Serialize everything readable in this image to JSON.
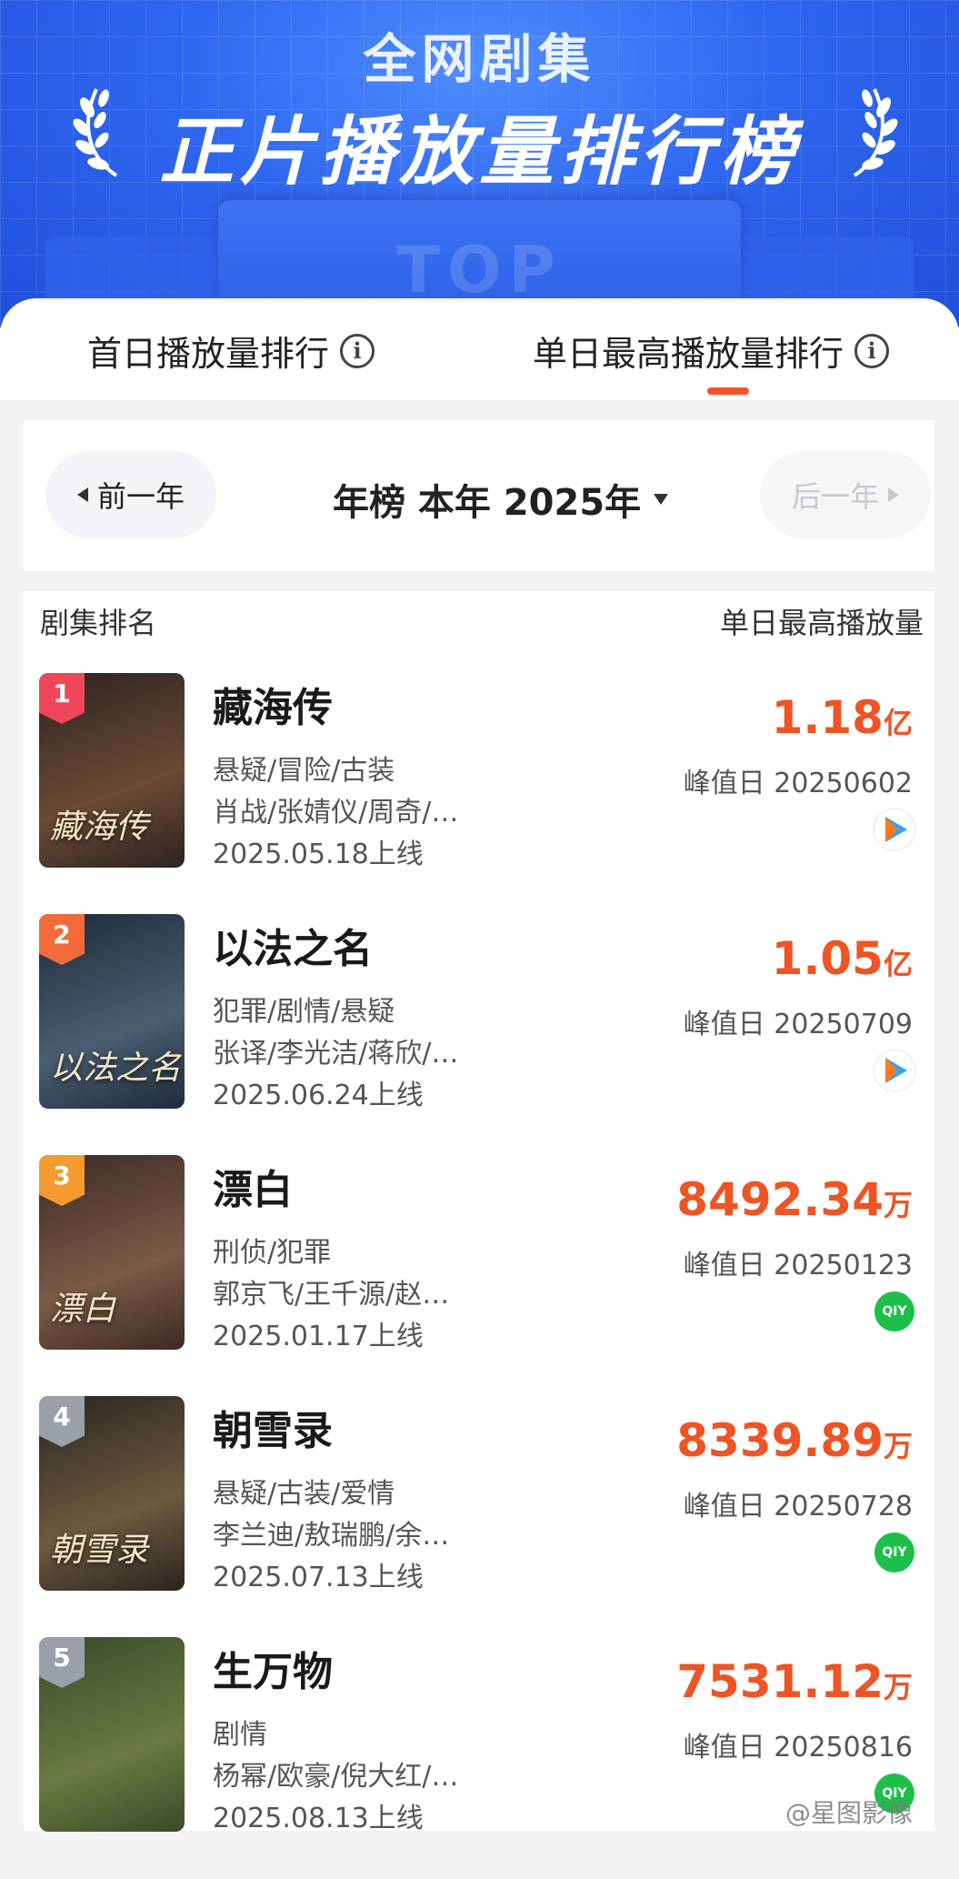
{
  "header": {
    "title_line1": "全网剧集",
    "title_line2": "正片播放量排行榜",
    "podium_text": "TOP"
  },
  "tabs": [
    {
      "label": "首日播放量排行",
      "active": false
    },
    {
      "label": "单日最高播放量排行",
      "active": true
    }
  ],
  "year_selector": {
    "prev_label": "前一年",
    "current_label": "年榜 本年 2025年",
    "next_label": "后一年"
  },
  "list_header": {
    "left": "剧集排名",
    "right": "单日最高播放量"
  },
  "rows": [
    {
      "rank": "1",
      "rank_color": "#f0465a",
      "name": "藏海传",
      "genre": "悬疑/冒险/古装",
      "cast": "肖战/张婧仪/周奇/…",
      "date": "2025.05.18上线",
      "views": "1.18",
      "unit": "亿",
      "peak": "峰值日 20250602",
      "platform": "tencent-video-icon",
      "poster_text": "藏海传",
      "poster_colors": [
        "#2a2420",
        "#6b4a36"
      ]
    },
    {
      "rank": "2",
      "rank_color": "#f36b3b",
      "name": "以法之名",
      "genre": "犯罪/剧情/悬疑",
      "cast": "张译/李光洁/蒋欣/…",
      "date": "2025.06.24上线",
      "views": "1.05",
      "unit": "亿",
      "peak": "峰值日 20250709",
      "platform": "tencent-video-icon",
      "poster_text": "以法之名",
      "poster_colors": [
        "#1f2b3a",
        "#4a5e72"
      ]
    },
    {
      "rank": "3",
      "rank_color": "#f59a2e",
      "name": "漂白",
      "genre": "刑侦/犯罪",
      "cast": "郭京飞/王千源/赵…",
      "date": "2025.01.17上线",
      "views": "8492.34",
      "unit": "万",
      "peak": "峰值日 20250123",
      "platform": "iqiyi-icon",
      "poster_text": "漂白",
      "poster_colors": [
        "#3b2a24",
        "#7a5a48"
      ]
    },
    {
      "rank": "4",
      "rank_color": "#9aa0a8",
      "name": "朝雪录",
      "genre": "悬疑/古装/爱情",
      "cast": "李兰迪/敖瑞鹏/余…",
      "date": "2025.07.13上线",
      "views": "8339.89",
      "unit": "万",
      "peak": "峰值日 20250728",
      "platform": "iqiyi-icon",
      "poster_text": "朝雪录",
      "poster_colors": [
        "#2b2520",
        "#6a5a40"
      ]
    },
    {
      "rank": "5",
      "rank_color": "#9aa0a8",
      "name": "生万物",
      "genre": "剧情",
      "cast": "杨幂/欧豪/倪大红/…",
      "date": "2025.08.13上线",
      "views": "7531.12",
      "unit": "万",
      "peak": "峰值日 20250816",
      "platform": "iqiyi-icon",
      "poster_text": "",
      "poster_colors": [
        "#3a4a2c",
        "#6a7a40"
      ]
    }
  ],
  "watermark": "@星图影像",
  "colors": {
    "accent": "#ee5424",
    "brand_blue": "#2f66ef"
  }
}
